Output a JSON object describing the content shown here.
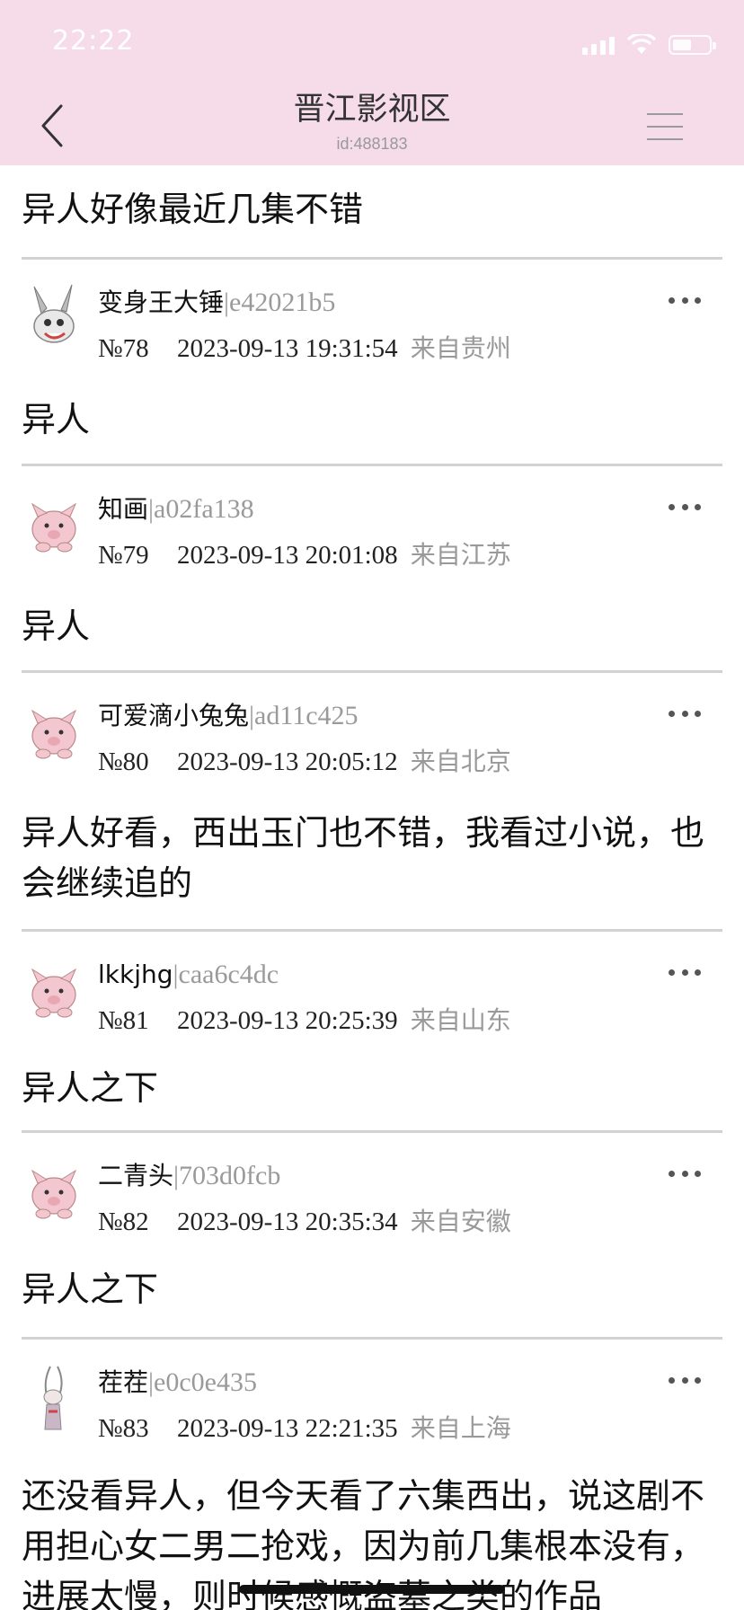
{
  "status_bar": {
    "time": "22:22",
    "battery_level": 0.5
  },
  "header": {
    "title": "晋江影视区",
    "subtitle": "id:488183"
  },
  "thread": {
    "title": "异人好像最近几集不错"
  },
  "posts": [
    {
      "username": "变身王大锤",
      "user_id": "|e42021b5",
      "floor": "№78",
      "datetime": "2023-09-13 19:31:54",
      "location": "来自贵州",
      "content": "异人"
    },
    {
      "username": "知画",
      "user_id": "|a02fa138",
      "floor": "№79",
      "datetime": "2023-09-13 20:01:08",
      "location": "来自江苏",
      "content": "异人"
    },
    {
      "username": "可爱滴小兔兔",
      "user_id": "|ad11c425",
      "floor": "№80",
      "datetime": "2023-09-13 20:05:12",
      "location": "来自北京",
      "content": "异人好看，西出玉门也不错，我看过小说，也会继续追的"
    },
    {
      "username": "lkkjhg",
      "user_id": "|caa6c4dc",
      "floor": "№81",
      "datetime": "2023-09-13 20:25:39",
      "location": "来自山东",
      "content": "异人之下"
    },
    {
      "username": "二青头",
      "user_id": "|703d0fcb",
      "floor": "№82",
      "datetime": "2023-09-13 20:35:34",
      "location": "来自安徽",
      "content": "异人之下"
    },
    {
      "username": "茬茬",
      "user_id": "|e0c0e435",
      "floor": "№83",
      "datetime": "2023-09-13 22:21:35",
      "location": "来自上海",
      "content": "还没看异人，但今天看了六集西出，说这剧不用担心女二男二抢戏，因为前几集根本没有，进展太慢，则时候感慨盗墓之类的作品"
    }
  ],
  "colors": {
    "header_bg": "#f6dbe9",
    "meta_gray": "#9a9a9a"
  }
}
